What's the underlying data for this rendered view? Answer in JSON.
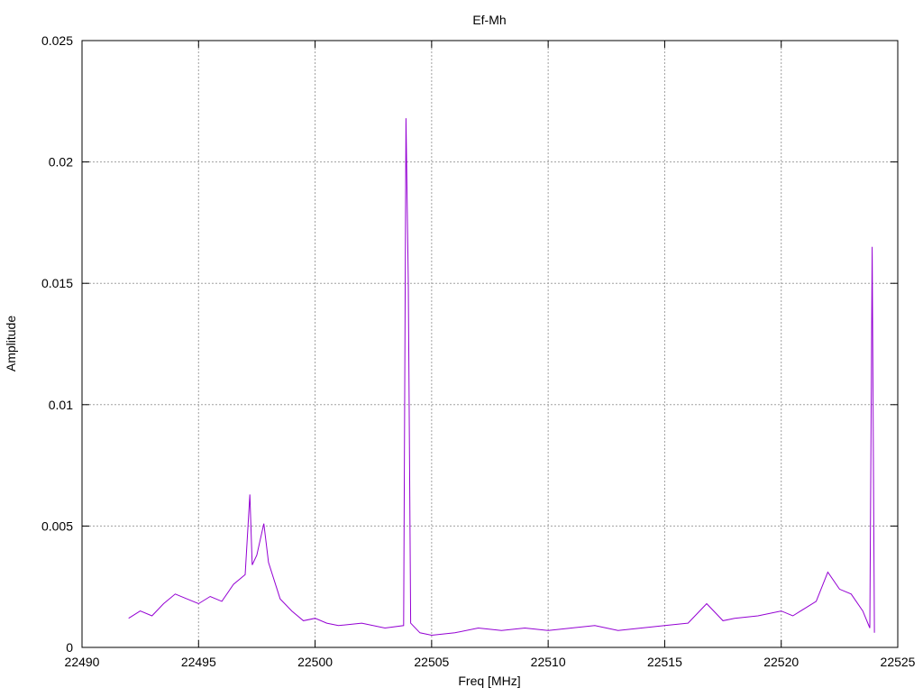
{
  "chart_data": {
    "type": "line",
    "title": "Ef-Mh",
    "xlabel": "Freq [MHz]",
    "ylabel": "Amplitude",
    "xlim": [
      22490,
      22525
    ],
    "ylim": [
      0,
      0.025
    ],
    "x_ticks": [
      22490,
      22495,
      22500,
      22505,
      22510,
      22515,
      22520,
      22525
    ],
    "x_tick_labels": [
      "22490",
      "22495",
      "22500",
      "22505",
      "22510",
      "22515",
      "22520",
      "22525"
    ],
    "y_ticks": [
      0,
      0.005,
      0.01,
      0.015,
      0.02,
      0.025
    ],
    "y_tick_labels": [
      "0",
      "0.005",
      "0.01",
      "0.015",
      "0.02",
      "0.025"
    ],
    "grid": true,
    "legend": "none",
    "line_color": "#9400d3",
    "series": [
      {
        "x": [
          22492.0,
          22492.5,
          22493.0,
          22493.5,
          22494.0,
          22494.5,
          22495.0,
          22495.5,
          22496.0,
          22496.5,
          22497.0,
          22497.2,
          22497.3,
          22497.5,
          22497.8,
          22498.0,
          22498.5,
          22499.0,
          22499.5,
          22500.0,
          22500.5,
          22501.0,
          22502.0,
          22503.0,
          22503.8,
          22503.9,
          22504.0,
          22504.1,
          22504.5,
          22505.0,
          22506.0,
          22507.0,
          22508.0,
          22509.0,
          22510.0,
          22511.0,
          22512.0,
          22513.0,
          22514.0,
          22515.0,
          22516.0,
          22516.8,
          22517.5,
          22518.0,
          22519.0,
          22520.0,
          22520.5,
          22521.0,
          22521.5,
          22522.0,
          22522.5,
          22523.0,
          22523.5,
          22523.8,
          22523.9,
          22524.0
        ],
        "y": [
          0.0012,
          0.0015,
          0.0013,
          0.0018,
          0.0022,
          0.002,
          0.0018,
          0.0021,
          0.0019,
          0.0026,
          0.003,
          0.0063,
          0.0034,
          0.0038,
          0.0051,
          0.0035,
          0.002,
          0.0015,
          0.0011,
          0.0012,
          0.001,
          0.0009,
          0.001,
          0.0008,
          0.0009,
          0.0218,
          0.015,
          0.001,
          0.0006,
          0.0005,
          0.0006,
          0.0008,
          0.0007,
          0.0008,
          0.0007,
          0.0008,
          0.0009,
          0.0007,
          0.0008,
          0.0009,
          0.001,
          0.0018,
          0.0011,
          0.0012,
          0.0013,
          0.0015,
          0.0013,
          0.0016,
          0.0019,
          0.0031,
          0.0024,
          0.0022,
          0.0015,
          0.0008,
          0.0165,
          0.0006
        ]
      }
    ]
  }
}
